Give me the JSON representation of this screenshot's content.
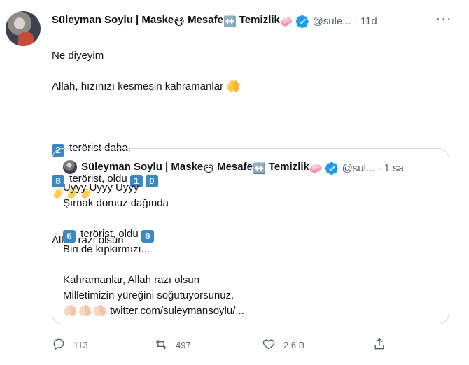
{
  "tweet": {
    "author_name": "Süleyman Soylu | Maske",
    "author_name_mid": " Mesafe",
    "author_name_end": " Temizlik",
    "handle": "@sule...",
    "separator": "·",
    "time": "11d",
    "more_label": "···",
    "lines": {
      "l1": "Ne diyeyim",
      "l2": "Allah, hızınızı kesmesin kahramanlar",
      "l3_num": "2",
      "l3": " terörist daha,",
      "l4_num": "8",
      "l4": " terörist, oldu ",
      "l4_num2": "1",
      "l4_num3": "0",
      "l5": "Allah razı olsun"
    },
    "actions": {
      "reply": "113",
      "retweet": "497",
      "like": "2,6 B"
    }
  },
  "quote": {
    "author_name": "Süleyman Soylu | Maske",
    "author_name_mid": " Mesafe",
    "author_name_end": " Temizlik",
    "handle": "@sul...",
    "separator": "·",
    "time": "1 sa",
    "lines": {
      "l1": "Uyyy Uyyy Uyyy",
      "l2": "Şırnak domuz dağında",
      "l3_num": "6",
      "l3": " terörist, oldu ",
      "l3_num2": "8",
      "l4": "Biri de kıpkırmızı...",
      "l5": "Kahramanlar, Allah razı olsun",
      "l6": "Milletimizin yüreğini soğutuyorsunuz.",
      "link": "twitter.com/suleymansoylu/..."
    }
  },
  "colors": {
    "accent": "#1d9bf0",
    "muted": "#536471",
    "border": "#cfd9de",
    "keycap": "#3b88c3"
  },
  "icons": [
    "mask-emoji",
    "left-right-arrow-emoji",
    "soap-emoji",
    "verified-badge-icon",
    "hands-emoji",
    "clapping-emoji",
    "reply-icon",
    "retweet-icon",
    "like-icon",
    "share-icon"
  ]
}
